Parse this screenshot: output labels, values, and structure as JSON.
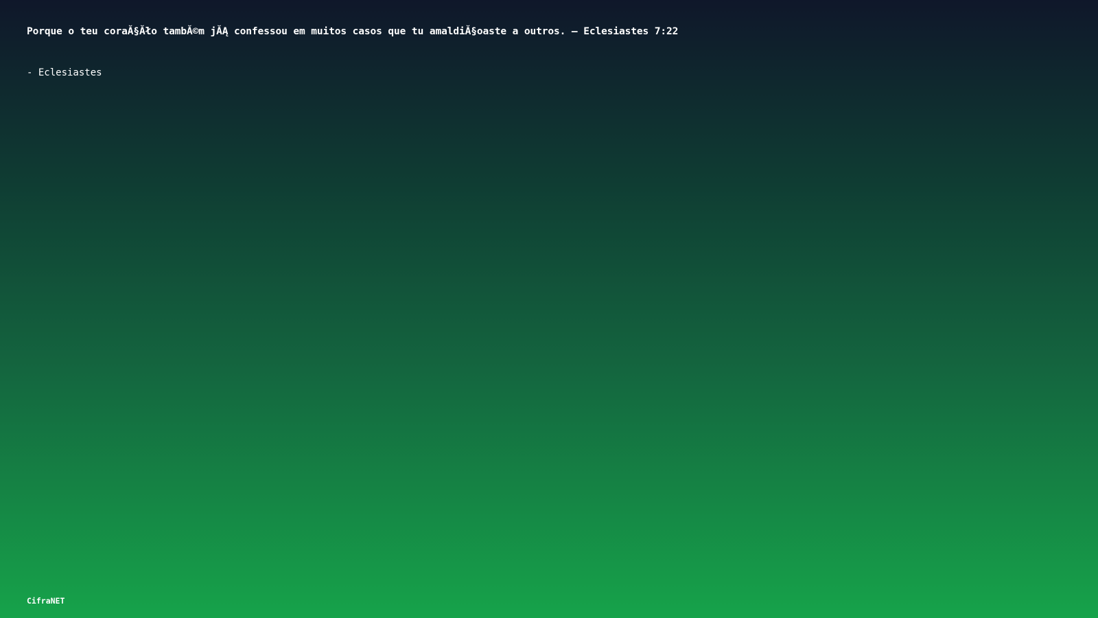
{
  "verse": {
    "text": "Porque o teu coraĂ§Ăło tambĂ©m jĂĄ confessou em muitos casos que tu amaldiĂ§oaste a outros. – Eclesiastes 7:22",
    "attribution": "- Eclesiastes"
  },
  "brand": {
    "name": "CifraNET"
  }
}
